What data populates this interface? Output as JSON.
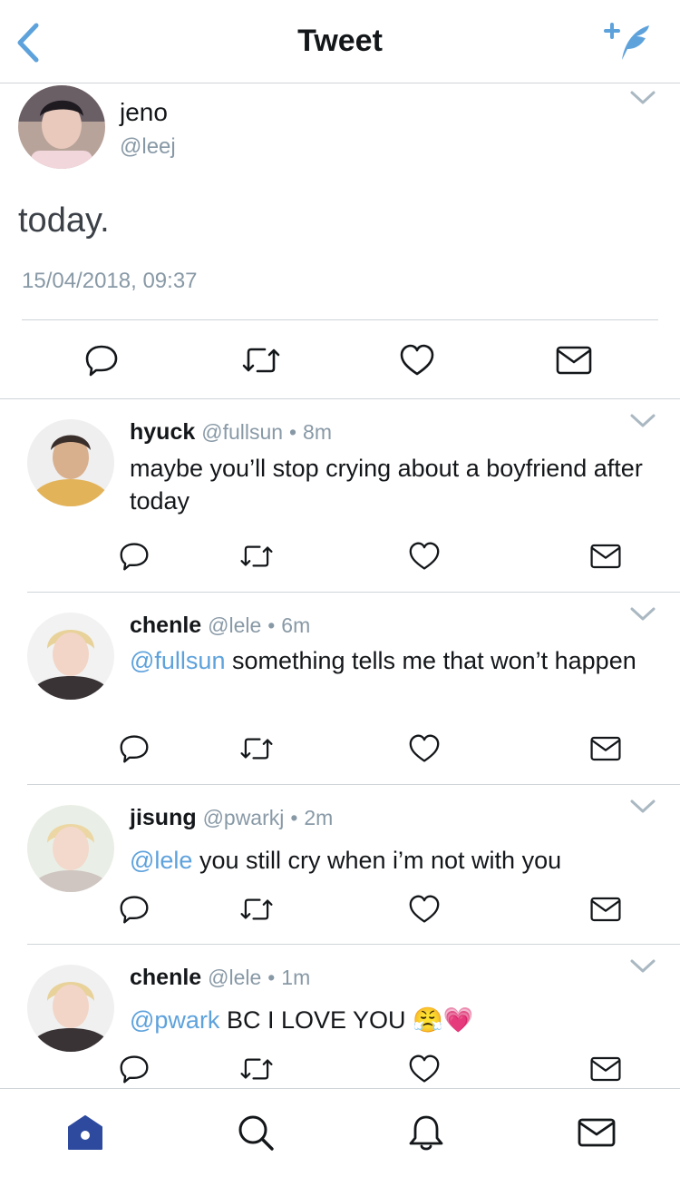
{
  "header": {
    "title": "Tweet"
  },
  "main_tweet": {
    "name": "jeno",
    "handle": "@leej",
    "text": "today.",
    "timestamp": "15/04/2018, 09:37"
  },
  "replies": [
    {
      "name": "hyuck",
      "handle": "@fullsun",
      "dot": "•",
      "time": "8m",
      "mention": "",
      "text": "maybe you’ll stop crying about a boyfriend after today",
      "emoji": ""
    },
    {
      "name": "chenle",
      "handle": "@lele",
      "dot": "•",
      "time": "6m",
      "mention": "@fullsun",
      "text": " something tells me that won’t happen",
      "emoji": ""
    },
    {
      "name": "jisung",
      "handle": "@pwarkj",
      "dot": "•",
      "time": "2m",
      "mention": "@lele",
      "text": " you still cry when i’m not with you",
      "emoji": ""
    },
    {
      "name": "chenle",
      "handle": "@lele",
      "dot": "•",
      "time": "1m",
      "mention": "@pwark",
      "text": " BC I LOVE YOU ",
      "emoji": "😤💗"
    }
  ],
  "colors": {
    "accent": "#5ea2dc",
    "text": "#14171a",
    "muted": "#8899a6",
    "divider": "#cfd4d8",
    "home_active": "#2d4a9e"
  },
  "icons": {
    "header": [
      "back-chevron-icon",
      "compose-feather-icon"
    ],
    "actions": [
      "reply-icon",
      "retweet-icon",
      "like-icon",
      "dm-icon"
    ],
    "tabs": [
      "home-icon",
      "search-icon",
      "notifications-icon",
      "messages-icon"
    ]
  }
}
